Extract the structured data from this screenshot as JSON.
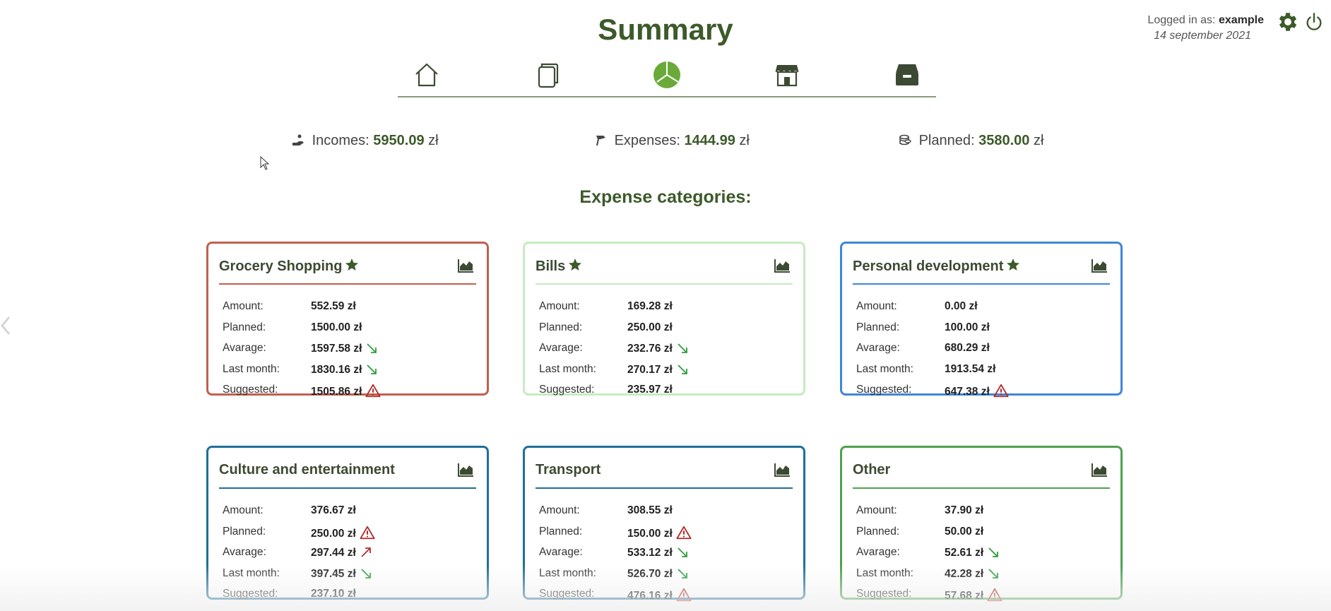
{
  "header": {
    "title": "Summary",
    "logged_in_label": "Logged in as:",
    "username": "example",
    "date": "14 september 2021"
  },
  "nav": {
    "items": [
      "home-icon",
      "documents-icon",
      "pie-chart-icon",
      "store-icon",
      "inbox-icon"
    ],
    "active": "pie-chart-icon"
  },
  "stats": {
    "incomes_label": "Incomes:",
    "incomes_value": "5950.09",
    "expenses_label": "Expenses:",
    "expenses_value": "1444.99",
    "planned_label": "Planned:",
    "planned_value": "3580.00",
    "currency": "zł"
  },
  "section_title": "Expense categories:",
  "row_labels": {
    "amount": "Amount:",
    "planned": "Planned:",
    "average": "Avarage:",
    "last_month": "Last month:",
    "suggested": "Suggested:"
  },
  "cards": [
    {
      "title": "Grocery Shopping",
      "favorite": true,
      "color": "#c0604f",
      "amount": "552.59 zł",
      "planned": "1500.00 zł",
      "average": "1597.58 zł",
      "last_month": "1830.16 zł",
      "suggested": "1505.86 zł",
      "indicators": {
        "planned": "",
        "average": "down",
        "last_month": "down",
        "suggested": "warning"
      }
    },
    {
      "title": "Bills",
      "favorite": true,
      "color": "#c8eac3",
      "amount": "169.28 zł",
      "planned": "250.00 zł",
      "average": "232.76 zł",
      "last_month": "270.17 zł",
      "suggested": "235.97 zł",
      "indicators": {
        "planned": "",
        "average": "down",
        "last_month": "down",
        "suggested": ""
      }
    },
    {
      "title": "Personal development",
      "favorite": true,
      "color": "#3f86d8",
      "amount": "0.00 zł",
      "planned": "100.00 zł",
      "average": "680.29 zł",
      "last_month": "1913.54 zł",
      "suggested": "647.38 zł",
      "indicators": {
        "planned": "",
        "average": "",
        "last_month": "",
        "suggested": "warning"
      }
    },
    {
      "title": "Culture and entertainment",
      "favorite": false,
      "color": "#1f6f9a",
      "amount": "376.67 zł",
      "planned": "250.00 zł",
      "average": "297.44 zł",
      "last_month": "397.45 zł",
      "suggested": "237.10 zł",
      "indicators": {
        "planned": "warning",
        "average": "up",
        "last_month": "down",
        "suggested": ""
      }
    },
    {
      "title": "Transport",
      "favorite": false,
      "color": "#1f6f9a",
      "amount": "308.55 zł",
      "planned": "150.00 zł",
      "average": "533.12 zł",
      "last_month": "526.70 zł",
      "suggested": "476.16 zł",
      "indicators": {
        "planned": "warning",
        "average": "down",
        "last_month": "down",
        "suggested": "warning"
      }
    },
    {
      "title": "Other",
      "favorite": false,
      "color": "#4fa04f",
      "amount": "37.90 zł",
      "planned": "50.00 zł",
      "average": "52.61 zł",
      "last_month": "42.28 zł",
      "suggested": "57.68 zł",
      "indicators": {
        "planned": "",
        "average": "down",
        "last_month": "down",
        "suggested": "warning"
      }
    }
  ],
  "colors": {
    "brand_green": "#3d5a2a",
    "trend_down": "#2e9e3e",
    "trend_up": "#b03030",
    "warning": "#b02a2a"
  }
}
